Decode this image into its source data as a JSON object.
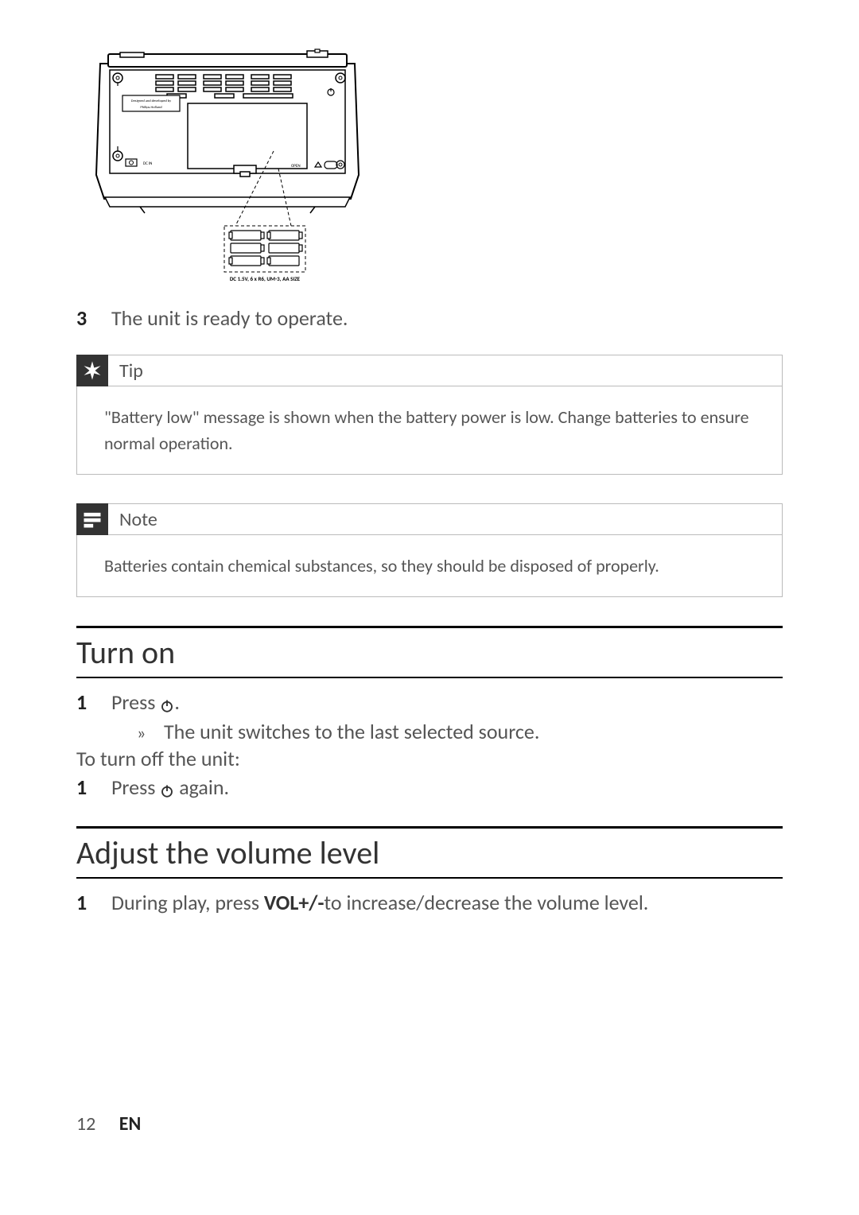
{
  "illustration": {
    "device_label_line1": "Designed and developed by",
    "device_label_line2": "Philips.Holland",
    "port_label": "DC IN",
    "open_label": "OPEN",
    "battery_caption": "DC 1.5V, 6 x R6, UM-3, AA SIZE"
  },
  "step3": {
    "num": "3",
    "text": "The unit is ready to operate."
  },
  "tip": {
    "title": "Tip",
    "body": "\"Battery low\" message is shown when the battery power is low. Change batteries to ensure normal operation."
  },
  "note": {
    "title": "Note",
    "body": "Batteries contain chemical substances, so they should be disposed of properly."
  },
  "turn_on": {
    "heading": "Turn on",
    "step1_num": "1",
    "step1_prefix": "Press ",
    "step1_suffix": ".",
    "sub_marker": "»",
    "sub_text": "The unit switches to the last selected source.",
    "to_turn_off": "To turn off the unit:",
    "step2_num": "1",
    "step2_prefix": "Press ",
    "step2_suffix": " again."
  },
  "adjust_volume": {
    "heading": "Adjust the volume level",
    "step1_num": "1",
    "step1_prefix": "During play, press ",
    "step1_bold": "VOL+/-",
    "step1_suffix": "to increase/decrease the volume level."
  },
  "footer": {
    "page": "12",
    "lang": "EN"
  }
}
